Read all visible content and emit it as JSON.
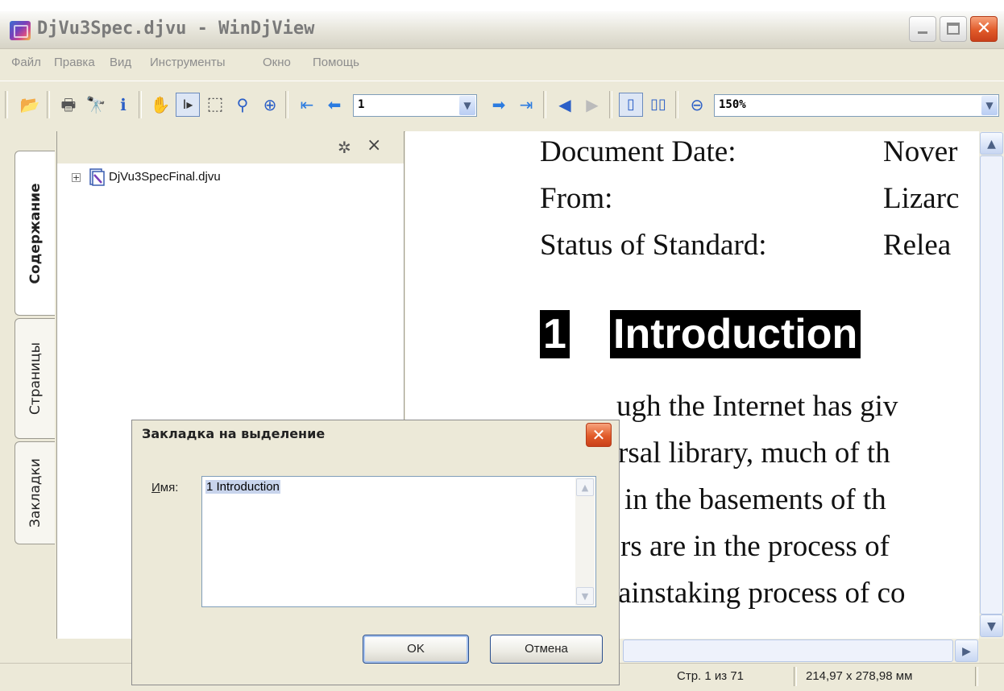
{
  "window": {
    "title": "DjVu3Spec.djvu - WinDjView"
  },
  "menu": [
    "Файл",
    "Правка",
    "Вид",
    "Инструменты",
    "Окно",
    "Помощь"
  ],
  "toolbar": {
    "page_value": "1",
    "zoom_value": "150%"
  },
  "side_tabs": {
    "contents": "Содержание",
    "pages": "Страницы",
    "bookmarks": "Закладки"
  },
  "tree": {
    "root_label": "DjVu3SpecFinal.djvu"
  },
  "document": {
    "rows": [
      {
        "label": "Document Date:",
        "value": "Nover"
      },
      {
        "label": "From:",
        "value": "Lizarc"
      },
      {
        "label": "Status of Standard:",
        "value": "Relea"
      }
    ],
    "heading_number": "1",
    "heading_text": "Introduction",
    "body_lines": [
      "ugh the Internet has giv",
      "rsal library, much of th",
      "in the basements of th",
      "rs are in the process of",
      "ainstaking process of co"
    ]
  },
  "status": {
    "page": "Стр. 1 из 71",
    "size": "214,97 x 278,98 мм"
  },
  "dialog": {
    "title": "Закладка на выделение",
    "name_label_underlined": "И",
    "name_label_rest": "мя:",
    "name_value": "1 Introduction",
    "ok": "OK",
    "cancel": "Отмена"
  }
}
